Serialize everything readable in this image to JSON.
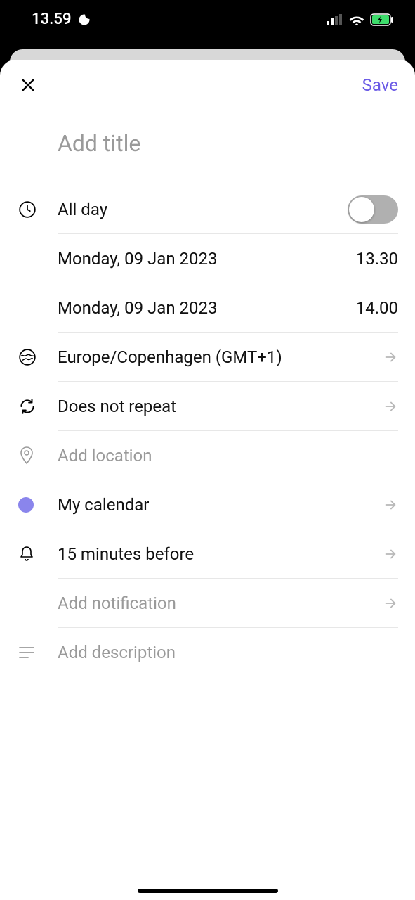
{
  "status": {
    "time": "13.59"
  },
  "header": {
    "save_label": "Save"
  },
  "title": {
    "placeholder": "Add title"
  },
  "allday": {
    "label": "All day",
    "on": false
  },
  "start": {
    "date": "Monday, 09 Jan 2023",
    "time": "13.30"
  },
  "end": {
    "date": "Monday, 09 Jan 2023",
    "time": "14.00"
  },
  "timezone": {
    "label": "Europe/Copenhagen (GMT+1)"
  },
  "repeat": {
    "label": "Does not repeat"
  },
  "location": {
    "placeholder": "Add location"
  },
  "calendar": {
    "label": "My calendar",
    "color": "#8a85ec"
  },
  "notification": {
    "label": "15 minutes before"
  },
  "add_notification": {
    "placeholder": "Add notification"
  },
  "description": {
    "placeholder": "Add description"
  }
}
